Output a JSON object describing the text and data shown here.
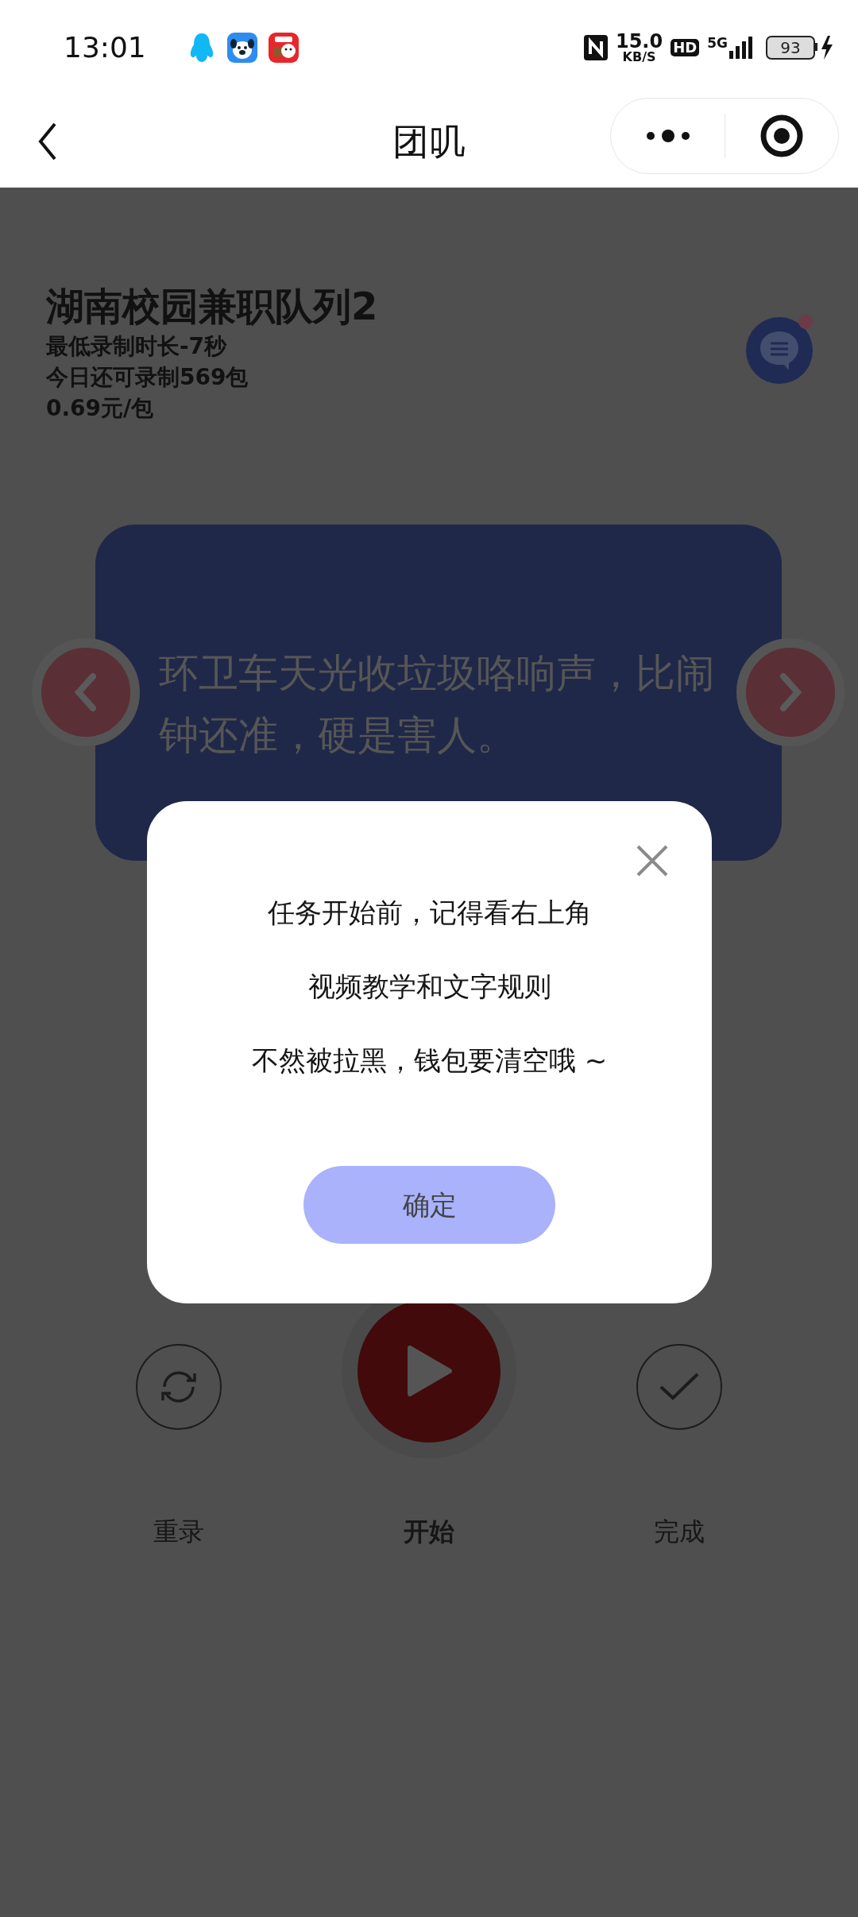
{
  "status_bar": {
    "time": "13:01",
    "speed": "15.0",
    "speed_unit": "KB/S",
    "hd": "HD",
    "network": "5G",
    "battery": "93"
  },
  "nav": {
    "title": "团叽"
  },
  "task": {
    "title": "湖南校园兼职队列2",
    "details": [
      "最低录制时长-7秒",
      "今日还可录制569包",
      "0.69元/包"
    ]
  },
  "sentence_card": {
    "text": "环卫车天光收垃圾咯响声，比闹钟还准，硬是害人。"
  },
  "controls": [
    {
      "kind": "rerecord",
      "label": "重录"
    },
    {
      "kind": "play",
      "label": "开始"
    },
    {
      "kind": "done",
      "label": "完成"
    }
  ],
  "dialog": {
    "lines": [
      "任务开始前，记得看右上角",
      "视频教学和文字规则",
      "不然被拉黑，钱包要清空哦 ~"
    ],
    "button": "确定"
  }
}
